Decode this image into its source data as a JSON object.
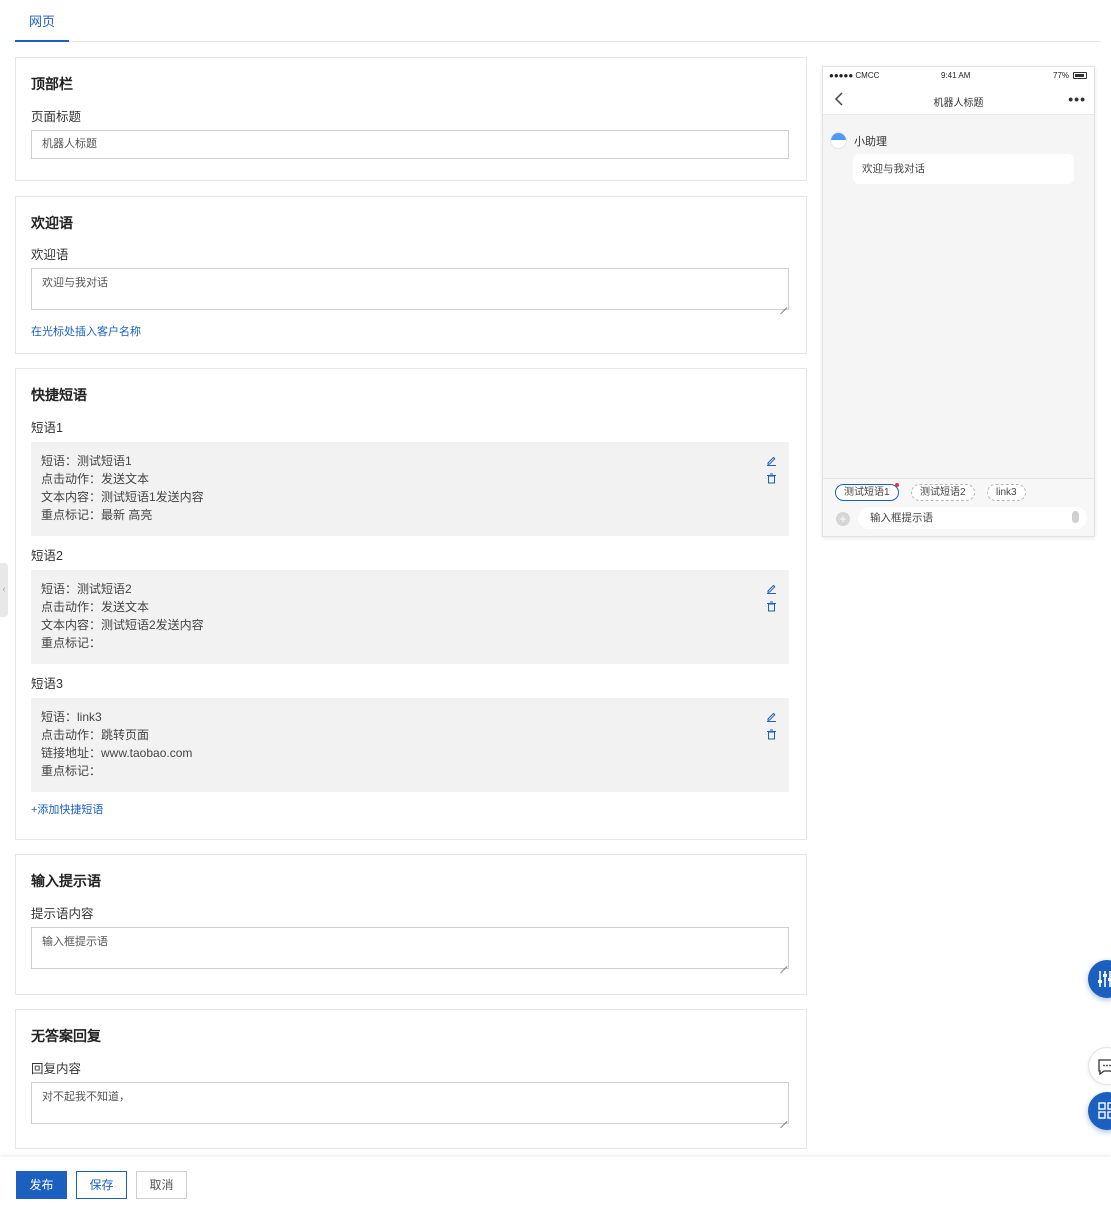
{
  "tabs": [
    {
      "label": "网页"
    }
  ],
  "top_bar": {
    "title": "顶部栏",
    "field_label": "页面标题",
    "value": "机器人标题"
  },
  "welcome": {
    "title": "欢迎语",
    "field_label": "欢迎语",
    "value": "欢迎与我对话",
    "insert_link": "在光标处插入客户名称"
  },
  "quick_phrases": {
    "title": "快捷短语",
    "items": [
      {
        "label": "短语1",
        "lines": [
          "短语：测试短语1",
          "点击动作：发送文本",
          "文本内容：测试短语1发送内容",
          "重点标记：最新 高亮"
        ]
      },
      {
        "label": "短语2",
        "lines": [
          "短语：测试短语2",
          "点击动作：发送文本",
          "文本内容：测试短语2发送内容",
          "重点标记："
        ]
      },
      {
        "label": "短语3",
        "lines": [
          "短语：link3",
          "点击动作：跳转页面",
          "链接地址：www.taobao.com",
          "重点标记："
        ]
      }
    ],
    "add_link": "+添加快捷短语"
  },
  "input_hint": {
    "title": "输入提示语",
    "field_label": "提示语内容",
    "value": "输入框提示语"
  },
  "no_answer": {
    "title": "无答案回复",
    "field_label": "回复内容",
    "value": "对不起我不知道，"
  },
  "buttons": {
    "publish": "发布",
    "save": "保存",
    "cancel": "取消"
  },
  "phone": {
    "status_carrier": "●●●●● CMCC",
    "status_time": "9:41 AM",
    "status_battery": "77%",
    "title": "机器人标题",
    "more": "•••",
    "bot_name": "小助理",
    "welcome_msg": "欢迎与我对话",
    "chips": [
      "测试短语1",
      "测试短语2",
      "link3"
    ],
    "input_placeholder": "输入框提示语"
  },
  "colors": {
    "accent": "#1b5fbf",
    "phrase_bg": "#f2f2f2",
    "border": "#e6e6e6"
  },
  "icons": [
    "edit-icon",
    "delete-icon",
    "back-arrow-icon",
    "more-icon",
    "plus-icon",
    "mic-icon",
    "sliders-icon",
    "chat-icon",
    "grid-icon"
  ]
}
